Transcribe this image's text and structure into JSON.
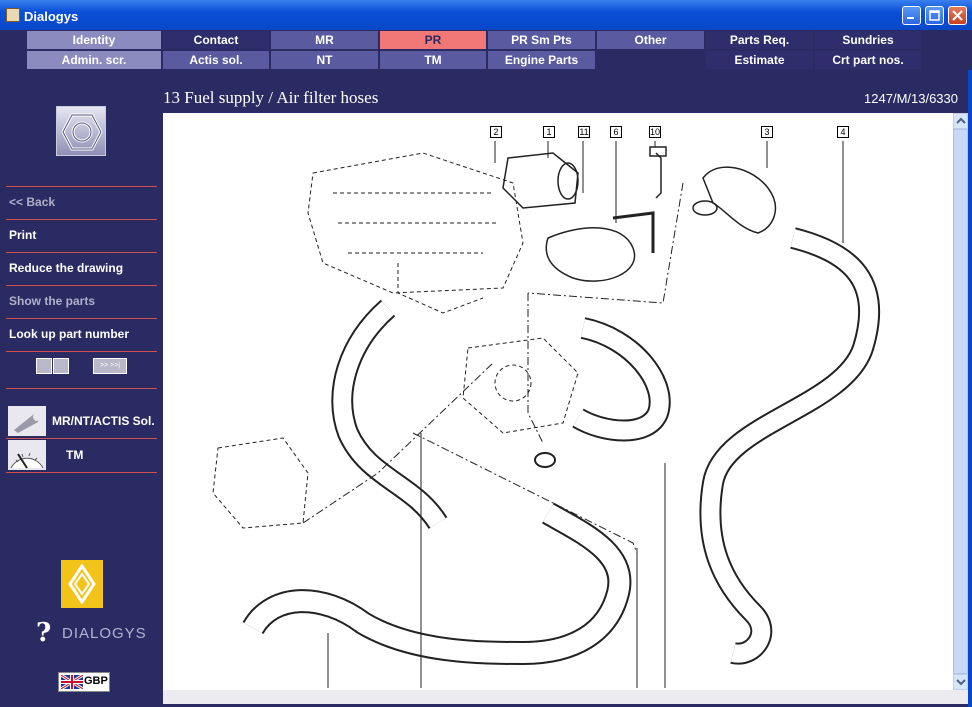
{
  "window": {
    "title": "Dialogys"
  },
  "menu": {
    "row1": [
      "Identity",
      "Contact",
      "MR",
      "PR",
      "PR Sm Pts",
      "Other",
      "Parts Req.",
      "Sundries"
    ],
    "row2": [
      "Admin. scr.",
      "Actis sol.",
      "NT",
      "TM",
      "Engine Parts",
      "Estimate",
      "Crt part nos."
    ]
  },
  "sidebar": {
    "back": "<< Back",
    "print": "Print",
    "reduce": "Reduce the drawing",
    "show_parts": "Show the parts",
    "lookup": "Look up part number",
    "nav_next": ">> >>|",
    "tool_mr": "MR/NT/ACTIS Sol.",
    "tool_tm": "TM",
    "brand": "DIALOGYS",
    "currency": "GBP"
  },
  "page": {
    "title": "13 Fuel supply / Air filter hoses",
    "ref": "1247/M/13/6330"
  },
  "callouts": [
    "2",
    "1",
    "11",
    "6",
    "10",
    "3",
    "4"
  ],
  "colors": {
    "background": "#2b2b63",
    "active_tab": "#f27878",
    "separator": "#d05050",
    "titlebar": "#0a4fd6"
  },
  "icons": {
    "logo": "hexagon-nut-icon",
    "renault": "renault-diamond-icon",
    "flag": "uk-flag-icon"
  }
}
